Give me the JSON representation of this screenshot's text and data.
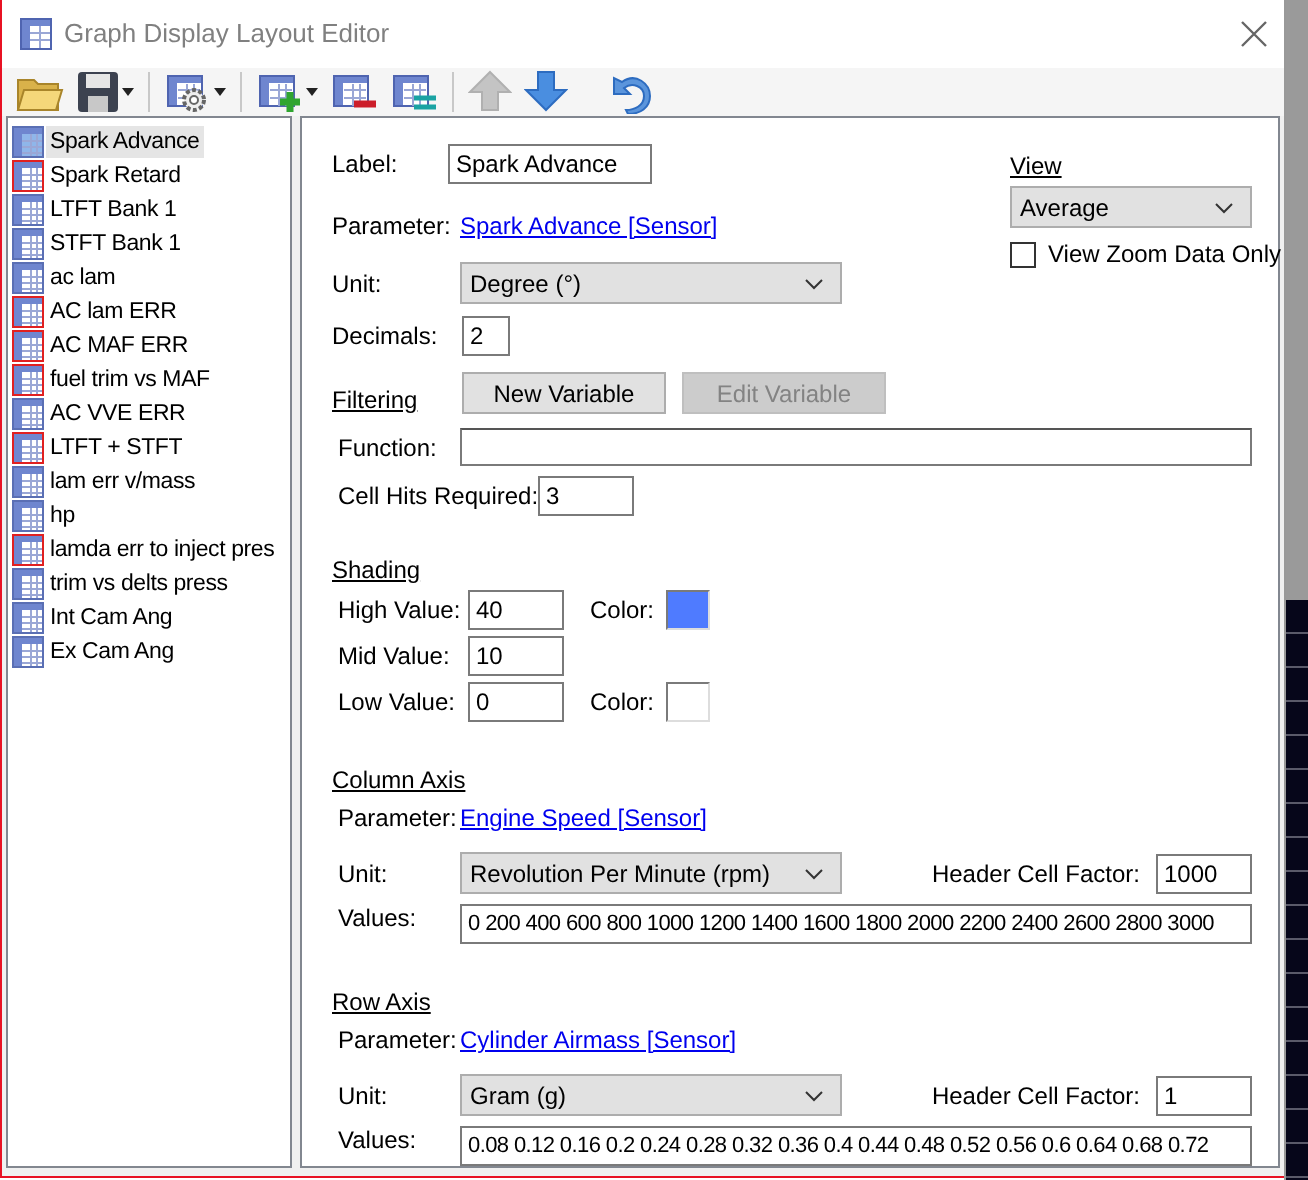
{
  "window": {
    "title": "Graph Display Layout Editor"
  },
  "toolbar": [
    {
      "kind": "open",
      "disabled": false,
      "dropdown": false
    },
    {
      "kind": "save",
      "disabled": false,
      "dropdown": true
    },
    {
      "kind": "settings",
      "disabled": false,
      "dropdown": true
    },
    {
      "kind": "add",
      "disabled": false,
      "dropdown": true
    },
    {
      "kind": "remove",
      "disabled": false,
      "dropdown": false
    },
    {
      "kind": "duplicate",
      "disabled": false,
      "dropdown": false
    },
    {
      "kind": "up",
      "disabled": true,
      "dropdown": false
    },
    {
      "kind": "down",
      "disabled": false,
      "dropdown": false
    },
    {
      "kind": "undo",
      "disabled": false,
      "dropdown": false
    }
  ],
  "layouts": [
    {
      "label": "Spark Advance",
      "selected": true,
      "kind": "plain"
    },
    {
      "label": "Spark Retard",
      "selected": false,
      "kind": "marked"
    },
    {
      "label": "LTFT Bank 1",
      "selected": false,
      "kind": "plain"
    },
    {
      "label": "STFT Bank 1",
      "selected": false,
      "kind": "plain"
    },
    {
      "label": "ac lam",
      "selected": false,
      "kind": "plain"
    },
    {
      "label": "AC lam ERR",
      "selected": false,
      "kind": "marked"
    },
    {
      "label": "AC MAF ERR",
      "selected": false,
      "kind": "marked"
    },
    {
      "label": "fuel trim vs MAF",
      "selected": false,
      "kind": "marked"
    },
    {
      "label": "AC VVE ERR",
      "selected": false,
      "kind": "plain"
    },
    {
      "label": "LTFT + STFT",
      "selected": false,
      "kind": "marked"
    },
    {
      "label": "lam err v/mass",
      "selected": false,
      "kind": "plain"
    },
    {
      "label": "hp",
      "selected": false,
      "kind": "plain"
    },
    {
      "label": "lamda err to inject pres",
      "selected": false,
      "kind": "marked"
    },
    {
      "label": "trim vs delts press",
      "selected": false,
      "kind": "plain"
    },
    {
      "label": "Int Cam Ang",
      "selected": false,
      "kind": "plain"
    },
    {
      "label": "Ex Cam Ang",
      "selected": false,
      "kind": "plain"
    }
  ],
  "form": {
    "label_label": "Label:",
    "label_value": "Spark Advance",
    "parameter_label": "Parameter:",
    "parameter": "Spark Advance [Sensor]",
    "unit_label": "Unit:",
    "unit": "Degree (°)",
    "decimals_label": "Decimals:",
    "decimals": "2"
  },
  "view": {
    "heading": "View",
    "value": "Average",
    "zoom_only": {
      "label": "View Zoom Data Only",
      "checked": false
    }
  },
  "filtering": {
    "heading": "Filtering",
    "buttons": [
      {
        "label": "New Variable",
        "disabled": false
      },
      {
        "label": "Edit Variable",
        "disabled": true
      }
    ],
    "function_label": "Function:",
    "cell_hits_label": "Cell Hits Required:",
    "cell_hits": "3"
  },
  "shading": {
    "heading": "Shading",
    "rows": [
      {
        "label": "High Value:",
        "value": "40",
        "color_label": "Color:",
        "color": "#4f7bff"
      },
      {
        "label": "Mid Value:",
        "value": "10"
      },
      {
        "label": "Low Value:",
        "value": "0",
        "color_label": "Color:",
        "color": "#ffffff"
      }
    ]
  },
  "axes": [
    {
      "heading": "Column Axis",
      "parameter_label": "Parameter:",
      "parameter": "Engine Speed [Sensor]",
      "unit_label": "Unit:",
      "unit": "Revolution Per Minute (rpm)",
      "factor_label": "Header Cell Factor:",
      "factor": "1000",
      "values_label": "Values:",
      "values": "0 200 400 600 800 1000 1200 1400 1600 1800 2000 2200 2400 2600 2800 3000"
    },
    {
      "heading": "Row Axis",
      "parameter_label": "Parameter:",
      "parameter": "Cylinder Airmass [Sensor]",
      "unit_label": "Unit:",
      "unit": "Gram (g)",
      "factor_label": "Header Cell Factor:",
      "factor": "1",
      "values_label": "Values:",
      "values": "0.08 0.12 0.16 0.2 0.24 0.28 0.32 0.36 0.4 0.44 0.48 0.52 0.56 0.6 0.64 0.68 0.72"
    }
  ]
}
